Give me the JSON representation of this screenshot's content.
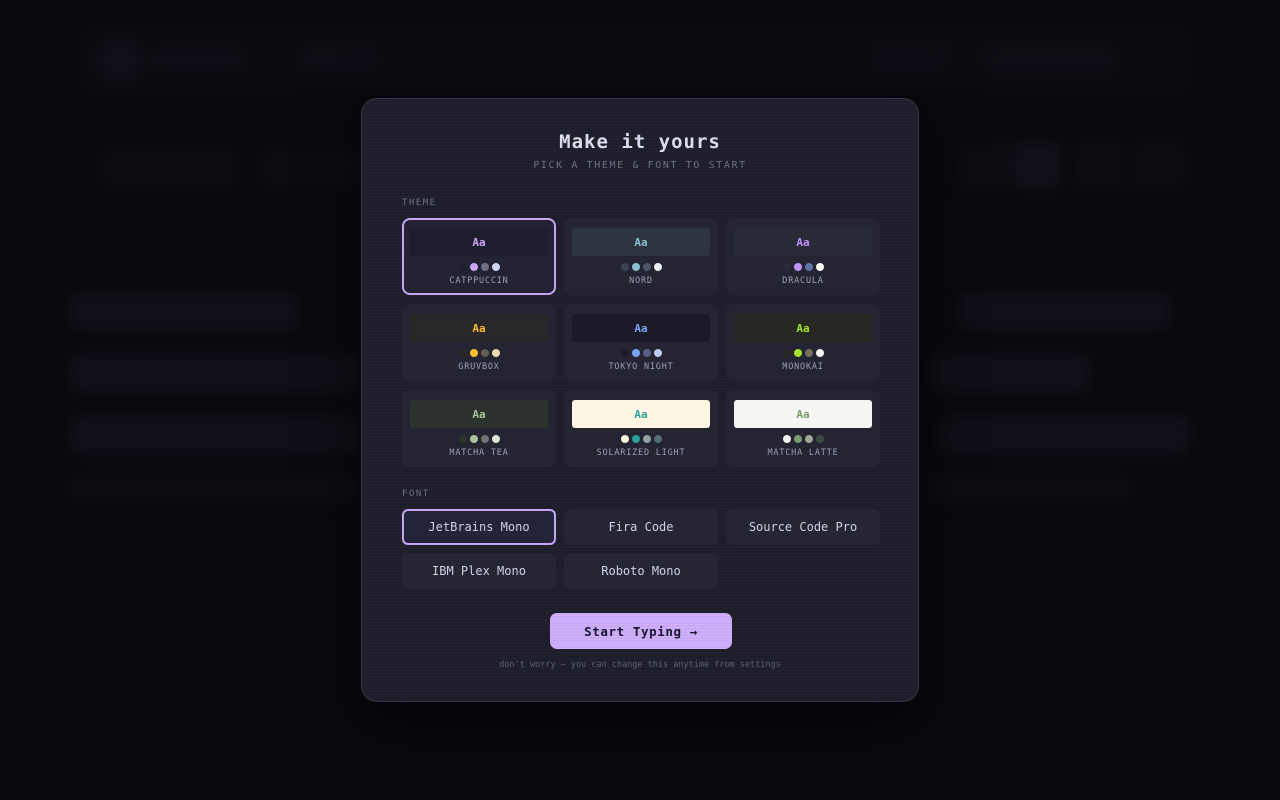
{
  "modal": {
    "title": "Make it yours",
    "subtitle": "PICK A THEME & FONT TO START",
    "theme_label": "THEME",
    "font_label": "FONT",
    "start_button": "Start Typing →",
    "footnote": "don't worry — you can change this anytime from settings"
  },
  "themes": [
    {
      "name": "CATPPUCCIN",
      "sample": "Aa",
      "selected": true,
      "preview_bg": "#1e1e2e",
      "preview_fg": "#cba6f7",
      "swatches": [
        "#1e1e2e",
        "#cba6f7",
        "#6c7086",
        "#cdd6f4"
      ]
    },
    {
      "name": "NORD",
      "sample": "Aa",
      "selected": false,
      "preview_bg": "#2e3440",
      "preview_fg": "#88c0d0",
      "swatches": [
        "#3b4252",
        "#88c0d0",
        "#4c566a",
        "#eceff4"
      ]
    },
    {
      "name": "DRACULA",
      "sample": "Aa",
      "selected": false,
      "preview_bg": "#282a36",
      "preview_fg": "#bd93f9",
      "swatches": [
        "#282a36",
        "#bd93f9",
        "#6272a4",
        "#f8f8f2"
      ]
    },
    {
      "name": "GRUVBOX",
      "sample": "Aa",
      "selected": false,
      "preview_bg": "#282828",
      "preview_fg": "#fabd2f",
      "swatches": [
        "#282828",
        "#fabd2f",
        "#665c54",
        "#ebdbb2"
      ]
    },
    {
      "name": "TOKYO NIGHT",
      "sample": "Aa",
      "selected": false,
      "preview_bg": "#1a1b26",
      "preview_fg": "#7aa2f7",
      "swatches": [
        "#1a1b26",
        "#7aa2f7",
        "#565f89",
        "#c0caf5"
      ]
    },
    {
      "name": "MONOKAI",
      "sample": "Aa",
      "selected": false,
      "preview_bg": "#272822",
      "preview_fg": "#a6e22e",
      "swatches": [
        "#272822",
        "#a6e22e",
        "#75715e",
        "#f8f8f2"
      ]
    },
    {
      "name": "MATCHA TEA",
      "sample": "Aa",
      "selected": false,
      "preview_bg": "#2c332e",
      "preview_fg": "#a9c19c",
      "swatches": [
        "#2c332e",
        "#a9c19c",
        "#6e7570",
        "#dde3d6"
      ]
    },
    {
      "name": "SOLARIZED LIGHT",
      "sample": "Aa",
      "selected": false,
      "preview_bg": "#fdf6e3",
      "preview_fg": "#2aa198",
      "swatches": [
        "#fdf6e3",
        "#2aa198",
        "#93a1a1",
        "#586e75"
      ]
    },
    {
      "name": "MATCHA LATTE",
      "sample": "Aa",
      "selected": false,
      "preview_bg": "#f5f6f1",
      "preview_fg": "#7a9a6e",
      "swatches": [
        "#f5f6f1",
        "#7a9a6e",
        "#a0a79c",
        "#3f4a40"
      ]
    }
  ],
  "fonts": [
    {
      "name": "JetBrains Mono",
      "selected": true
    },
    {
      "name": "Fira Code",
      "selected": false
    },
    {
      "name": "Source Code Pro",
      "selected": false
    },
    {
      "name": "IBM Plex Mono",
      "selected": false
    },
    {
      "name": "Roboto Mono",
      "selected": false
    }
  ]
}
